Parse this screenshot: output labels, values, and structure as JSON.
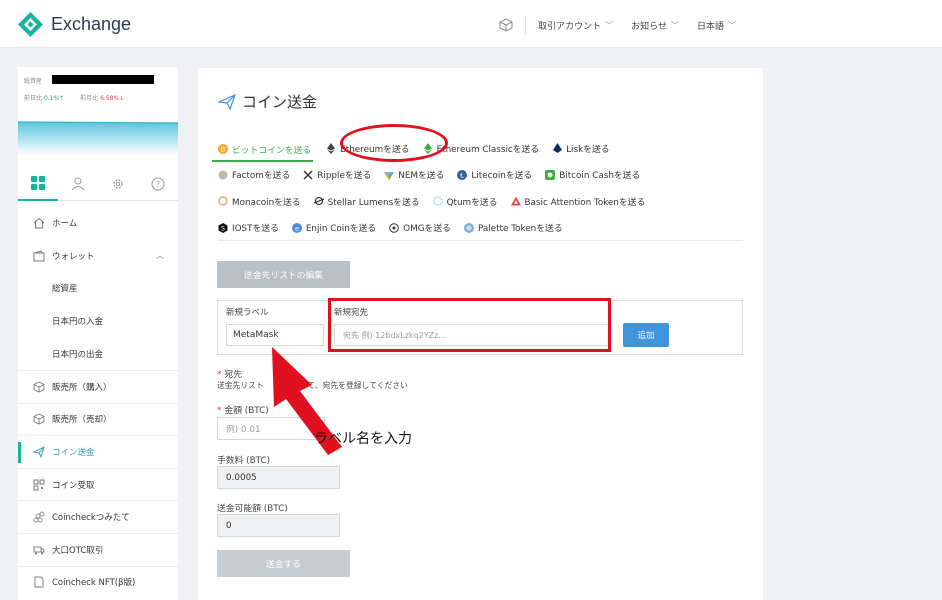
{
  "header": {
    "app_name": "Exchange",
    "nav": [
      "取引アカウント",
      "お知らせ",
      "日本語"
    ],
    "accent": "#16b3a3"
  },
  "balance": {
    "label": "総資産",
    "day_label": "前日比",
    "day_value": "0.1%↑",
    "month_label": "前月比",
    "month_value": "6.58%↓"
  },
  "sidebar": {
    "icon_tabs": [
      "grid-icon",
      "user-icon",
      "gear-icon",
      "help-icon"
    ],
    "items": [
      {
        "label": "ホーム",
        "icon": "home-icon"
      },
      {
        "label": "ウォレット",
        "icon": "wallet-icon"
      },
      {
        "label": "総資産"
      },
      {
        "label": "日本円の入金"
      },
      {
        "label": "日本円の出金"
      },
      {
        "label": "販売所（購入）",
        "icon": "cube-icon"
      },
      {
        "label": "販売所（売却）",
        "icon": "cube-icon"
      },
      {
        "label": "コイン送金",
        "icon": "paper-plane-icon"
      },
      {
        "label": "コイン受取",
        "icon": "qr-icon"
      },
      {
        "label": "Coincheckつみたて",
        "icon": "coins-icon"
      },
      {
        "label": "大口OTC取引",
        "icon": "truck-icon"
      },
      {
        "label": "Coincheck NFT(β版)",
        "icon": "nft-icon"
      }
    ]
  },
  "page": {
    "title": "コイン送金"
  },
  "tabs": [
    [
      "ビットコインを送る",
      "Ethereumを送る",
      "Ethereum Classicを送る",
      "Liskを送る"
    ],
    [
      "Factomを送る",
      "Rippleを送る",
      "NEMを送る",
      "Litecoinを送る",
      "Bitcoin Cashを送る"
    ],
    [
      "Monacoinを送る",
      "Stellar Lumensを送る",
      "Qtumを送る",
      "Basic Attention Tokenを送る"
    ],
    [
      "IOSTを送る",
      "Enjin Coinを送る",
      "OMGを送る",
      "Palette Tokenを送る"
    ]
  ],
  "form": {
    "edit_list_button": "送金先リストの編集",
    "new_label_title": "新規ラベル",
    "new_label_value": "MetaMask",
    "new_dest_title": "新規宛先",
    "new_dest_placeholder": "宛先 例) 12bdxLzkq2YZz...",
    "add_button": "追加",
    "dest_title": "宛先",
    "dest_help_a": "送金先リスト",
    "dest_help_b": "して、宛先を登録してください",
    "amount_title": "金額 (BTC)",
    "amount_placeholder": "例) 0.01",
    "fee_title": "手数料 (BTC)",
    "fee_value": "0.0005",
    "available_title": "送金可能額 (BTC)",
    "available_value": "0",
    "send_button": "送金する"
  },
  "annotation": {
    "text": "ラベル名を入力",
    "color": "#e0101e"
  }
}
